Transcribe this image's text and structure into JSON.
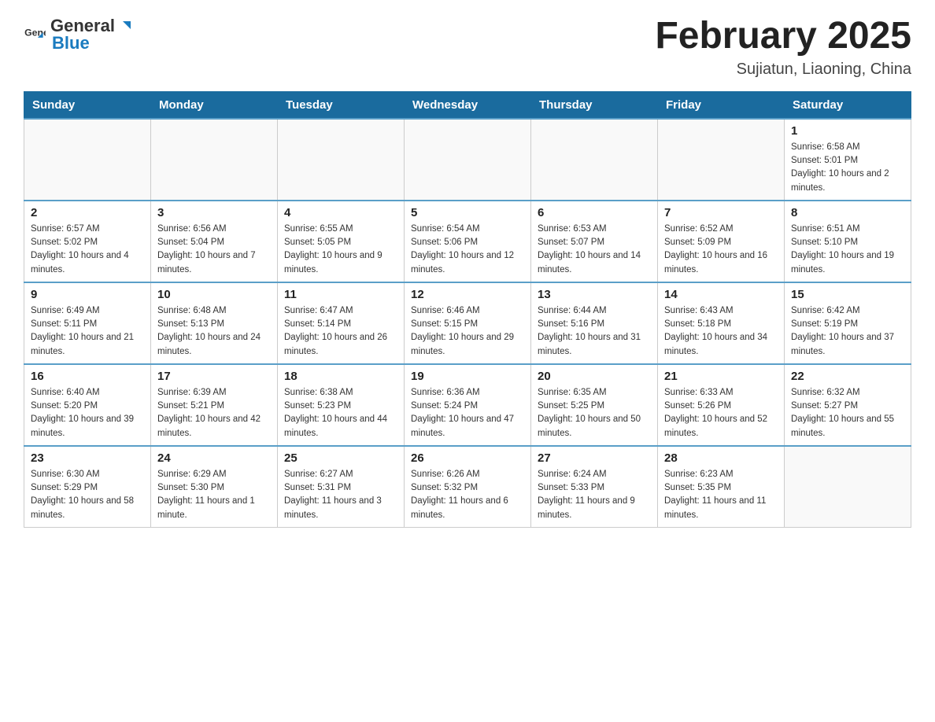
{
  "header": {
    "logo_general": "General",
    "logo_blue": "Blue",
    "month_title": "February 2025",
    "location": "Sujiatun, Liaoning, China"
  },
  "days_of_week": [
    "Sunday",
    "Monday",
    "Tuesday",
    "Wednesday",
    "Thursday",
    "Friday",
    "Saturday"
  ],
  "weeks": [
    [
      {
        "day": "",
        "info": ""
      },
      {
        "day": "",
        "info": ""
      },
      {
        "day": "",
        "info": ""
      },
      {
        "day": "",
        "info": ""
      },
      {
        "day": "",
        "info": ""
      },
      {
        "day": "",
        "info": ""
      },
      {
        "day": "1",
        "info": "Sunrise: 6:58 AM\nSunset: 5:01 PM\nDaylight: 10 hours and 2 minutes."
      }
    ],
    [
      {
        "day": "2",
        "info": "Sunrise: 6:57 AM\nSunset: 5:02 PM\nDaylight: 10 hours and 4 minutes."
      },
      {
        "day": "3",
        "info": "Sunrise: 6:56 AM\nSunset: 5:04 PM\nDaylight: 10 hours and 7 minutes."
      },
      {
        "day": "4",
        "info": "Sunrise: 6:55 AM\nSunset: 5:05 PM\nDaylight: 10 hours and 9 minutes."
      },
      {
        "day": "5",
        "info": "Sunrise: 6:54 AM\nSunset: 5:06 PM\nDaylight: 10 hours and 12 minutes."
      },
      {
        "day": "6",
        "info": "Sunrise: 6:53 AM\nSunset: 5:07 PM\nDaylight: 10 hours and 14 minutes."
      },
      {
        "day": "7",
        "info": "Sunrise: 6:52 AM\nSunset: 5:09 PM\nDaylight: 10 hours and 16 minutes."
      },
      {
        "day": "8",
        "info": "Sunrise: 6:51 AM\nSunset: 5:10 PM\nDaylight: 10 hours and 19 minutes."
      }
    ],
    [
      {
        "day": "9",
        "info": "Sunrise: 6:49 AM\nSunset: 5:11 PM\nDaylight: 10 hours and 21 minutes."
      },
      {
        "day": "10",
        "info": "Sunrise: 6:48 AM\nSunset: 5:13 PM\nDaylight: 10 hours and 24 minutes."
      },
      {
        "day": "11",
        "info": "Sunrise: 6:47 AM\nSunset: 5:14 PM\nDaylight: 10 hours and 26 minutes."
      },
      {
        "day": "12",
        "info": "Sunrise: 6:46 AM\nSunset: 5:15 PM\nDaylight: 10 hours and 29 minutes."
      },
      {
        "day": "13",
        "info": "Sunrise: 6:44 AM\nSunset: 5:16 PM\nDaylight: 10 hours and 31 minutes."
      },
      {
        "day": "14",
        "info": "Sunrise: 6:43 AM\nSunset: 5:18 PM\nDaylight: 10 hours and 34 minutes."
      },
      {
        "day": "15",
        "info": "Sunrise: 6:42 AM\nSunset: 5:19 PM\nDaylight: 10 hours and 37 minutes."
      }
    ],
    [
      {
        "day": "16",
        "info": "Sunrise: 6:40 AM\nSunset: 5:20 PM\nDaylight: 10 hours and 39 minutes."
      },
      {
        "day": "17",
        "info": "Sunrise: 6:39 AM\nSunset: 5:21 PM\nDaylight: 10 hours and 42 minutes."
      },
      {
        "day": "18",
        "info": "Sunrise: 6:38 AM\nSunset: 5:23 PM\nDaylight: 10 hours and 44 minutes."
      },
      {
        "day": "19",
        "info": "Sunrise: 6:36 AM\nSunset: 5:24 PM\nDaylight: 10 hours and 47 minutes."
      },
      {
        "day": "20",
        "info": "Sunrise: 6:35 AM\nSunset: 5:25 PM\nDaylight: 10 hours and 50 minutes."
      },
      {
        "day": "21",
        "info": "Sunrise: 6:33 AM\nSunset: 5:26 PM\nDaylight: 10 hours and 52 minutes."
      },
      {
        "day": "22",
        "info": "Sunrise: 6:32 AM\nSunset: 5:27 PM\nDaylight: 10 hours and 55 minutes."
      }
    ],
    [
      {
        "day": "23",
        "info": "Sunrise: 6:30 AM\nSunset: 5:29 PM\nDaylight: 10 hours and 58 minutes."
      },
      {
        "day": "24",
        "info": "Sunrise: 6:29 AM\nSunset: 5:30 PM\nDaylight: 11 hours and 1 minute."
      },
      {
        "day": "25",
        "info": "Sunrise: 6:27 AM\nSunset: 5:31 PM\nDaylight: 11 hours and 3 minutes."
      },
      {
        "day": "26",
        "info": "Sunrise: 6:26 AM\nSunset: 5:32 PM\nDaylight: 11 hours and 6 minutes."
      },
      {
        "day": "27",
        "info": "Sunrise: 6:24 AM\nSunset: 5:33 PM\nDaylight: 11 hours and 9 minutes."
      },
      {
        "day": "28",
        "info": "Sunrise: 6:23 AM\nSunset: 5:35 PM\nDaylight: 11 hours and 11 minutes."
      },
      {
        "day": "",
        "info": ""
      }
    ]
  ]
}
